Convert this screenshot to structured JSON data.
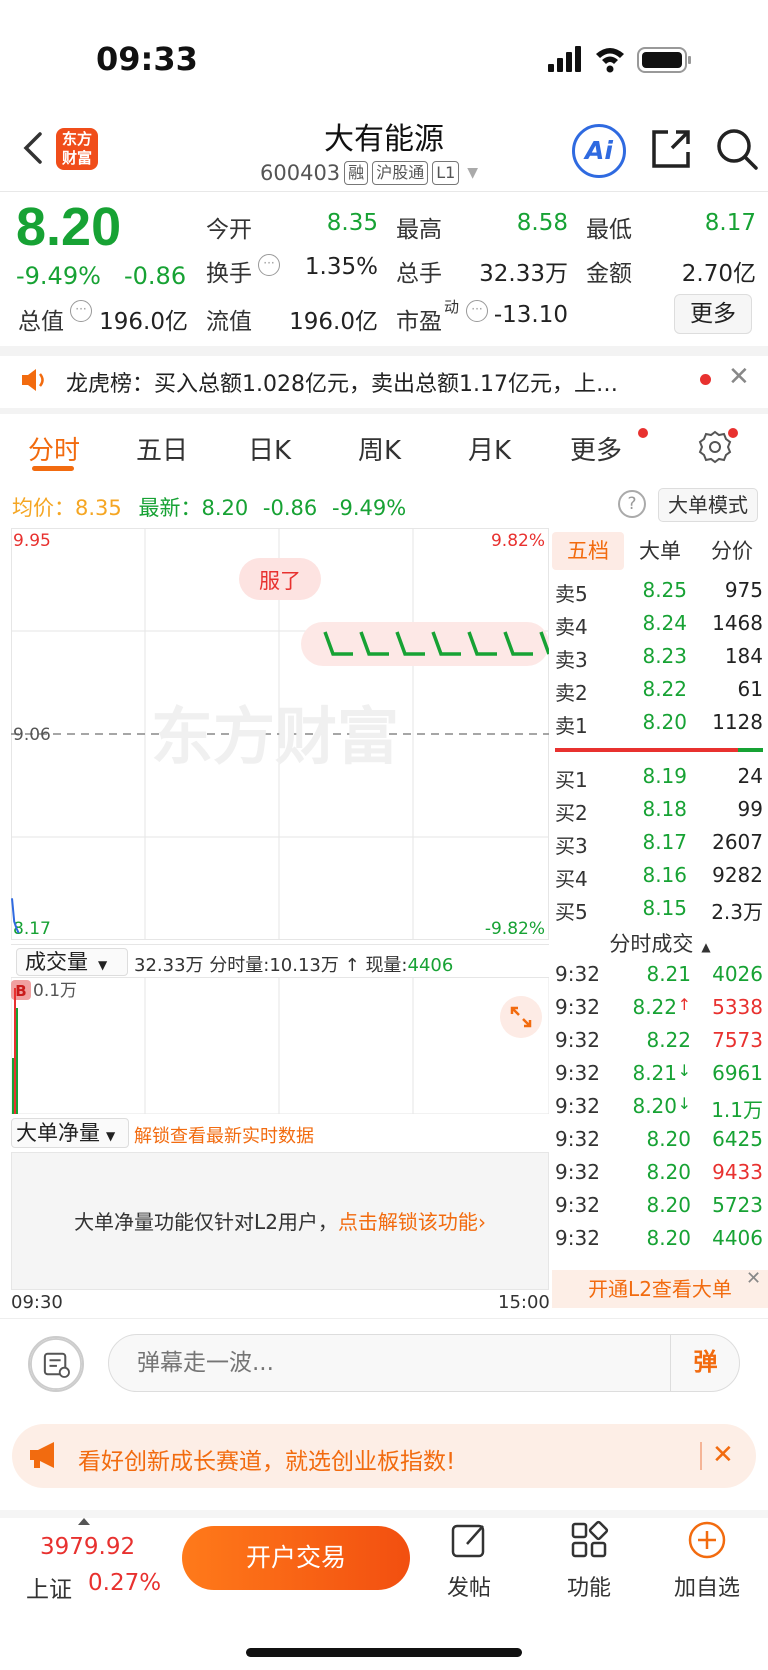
{
  "status": {
    "time": "09:33"
  },
  "header": {
    "logo_text_1": "东方",
    "logo_text_2": "财富",
    "name": "大有能源",
    "code": "600403",
    "tags": [
      "融",
      "沪股通",
      "L1"
    ],
    "ai_label": "Ai"
  },
  "quote": {
    "price": "8.20",
    "change_pct": "-9.49%",
    "change_amt": "-0.86",
    "fields": [
      {
        "label": "今开",
        "value": "8.35",
        "color": "green"
      },
      {
        "label": "最高",
        "value": "8.58",
        "color": "green"
      },
      {
        "label": "最低",
        "value": "8.17",
        "color": "green"
      },
      {
        "label": "换手",
        "value": "1.35%",
        "color": "black"
      },
      {
        "label": "总手",
        "value": "32.33万",
        "color": "black"
      },
      {
        "label": "金额",
        "value": "2.70亿",
        "color": "black"
      },
      {
        "label": "总值",
        "value": "196.0亿",
        "color": "black"
      },
      {
        "label": "流值",
        "value": "196.0亿",
        "color": "black"
      },
      {
        "label": "市盈",
        "value": "-13.10",
        "color": "black"
      }
    ],
    "pe_superscript": "动",
    "more_label": "更多"
  },
  "notice": {
    "text": "龙虎榜：买入总额1.028亿元，卖出总额1.17亿元，上…"
  },
  "chart_tabs": [
    "分时",
    "五日",
    "日K",
    "周K",
    "月K",
    "更多"
  ],
  "info_line": {
    "avg_label": "均价：",
    "avg_value": "8.35",
    "latest_label": "最新：",
    "latest_value": "8.20",
    "latest_change": "-0.86",
    "latest_pct": "-9.49%",
    "help": "?",
    "mode_button": "大单模式"
  },
  "chart": {
    "y_top": "9.95",
    "y_mid": "9.06",
    "y_bottom": "8.17",
    "pct_top": "9.82%",
    "pct_bottom": "-9.82%",
    "reaction_label": "服了",
    "watermark": "东方财富"
  },
  "chart_data": {
    "type": "line",
    "title": "",
    "x_range": [
      "09:30",
      "15:00"
    ],
    "ylim": [
      8.17,
      9.95
    ],
    "reference_price": 9.06,
    "series": [
      {
        "name": "",
        "x": [
          "09:30",
          "09:31",
          "09:32",
          "09:33"
        ],
        "values": [
          8.35,
          8.25,
          8.22,
          8.2
        ]
      }
    ],
    "grid": true
  },
  "order_book": {
    "tabs": [
      "五档",
      "大单",
      "分价"
    ],
    "asks": [
      {
        "label": "卖5",
        "price": "8.25",
        "vol": "975"
      },
      {
        "label": "卖4",
        "price": "8.24",
        "vol": "1468"
      },
      {
        "label": "卖3",
        "price": "8.23",
        "vol": "184"
      },
      {
        "label": "卖2",
        "price": "8.22",
        "vol": "61"
      },
      {
        "label": "卖1",
        "price": "8.20",
        "vol": "1128"
      }
    ],
    "bids": [
      {
        "label": "买1",
        "price": "8.19",
        "vol": "24"
      },
      {
        "label": "买2",
        "price": "8.18",
        "vol": "99"
      },
      {
        "label": "买3",
        "price": "8.17",
        "vol": "2607"
      },
      {
        "label": "买4",
        "price": "8.16",
        "vol": "9282"
      },
      {
        "label": "买5",
        "price": "8.15",
        "vol": "2.3万"
      }
    ]
  },
  "trades": {
    "header": "分时成交",
    "rows": [
      {
        "time": "9:32",
        "price": "8.21",
        "arrow": "",
        "vol": "4026",
        "vol_color": "green"
      },
      {
        "time": "9:32",
        "price": "8.22",
        "arrow": "↑",
        "vol": "5338",
        "vol_color": "red"
      },
      {
        "time": "9:32",
        "price": "8.22",
        "arrow": "",
        "vol": "7573",
        "vol_color": "red"
      },
      {
        "time": "9:32",
        "price": "8.21",
        "arrow": "↓",
        "vol": "6961",
        "vol_color": "green"
      },
      {
        "time": "9:32",
        "price": "8.20",
        "arrow": "↓",
        "vol": "1.1万",
        "vol_color": "green"
      },
      {
        "time": "9:32",
        "price": "8.20",
        "arrow": "",
        "vol": "6425",
        "vol_color": "green"
      },
      {
        "time": "9:32",
        "price": "8.20",
        "arrow": "",
        "vol": "9433",
        "vol_color": "red"
      },
      {
        "time": "9:32",
        "price": "8.20",
        "arrow": "",
        "vol": "5723",
        "vol_color": "green"
      },
      {
        "time": "9:32",
        "price": "8.20",
        "arrow": "",
        "vol": "4406",
        "vol_color": "green"
      }
    ],
    "l2_promo": "开通L2查看大单"
  },
  "volume": {
    "select_label": "成交量",
    "total": "32.33万",
    "period_label": "分时量:",
    "period_value": "10.13万",
    "current_label": "现量:",
    "current_value": "4406",
    "badge": "B",
    "axis_top": "0.1万"
  },
  "net_flow": {
    "select_label": "大单净量",
    "unlock_link": "解锁查看最新实时数据",
    "message": "大单净量功能仅针对L2用户，",
    "message_link": "点击解锁该功能"
  },
  "time_axis": {
    "start": "09:30",
    "end": "15:00"
  },
  "danmaku": {
    "placeholder": "弹幕走一波...",
    "send_label": "弹"
  },
  "promo": {
    "text": "看好创新成长赛道，就选创业板指数!"
  },
  "bottom_bar": {
    "index_value": "3979.92",
    "index_name": "上证",
    "index_pct": "0.27%",
    "trade_button": "开户交易",
    "post_label": "发帖",
    "function_label": "功能",
    "watchlist_label": "加自选"
  },
  "colors": {
    "up": "#e8312f",
    "down": "#17a234",
    "accent": "#f26b0f",
    "avg_line": "#f5a623",
    "price_line": "#2f6ae0"
  }
}
